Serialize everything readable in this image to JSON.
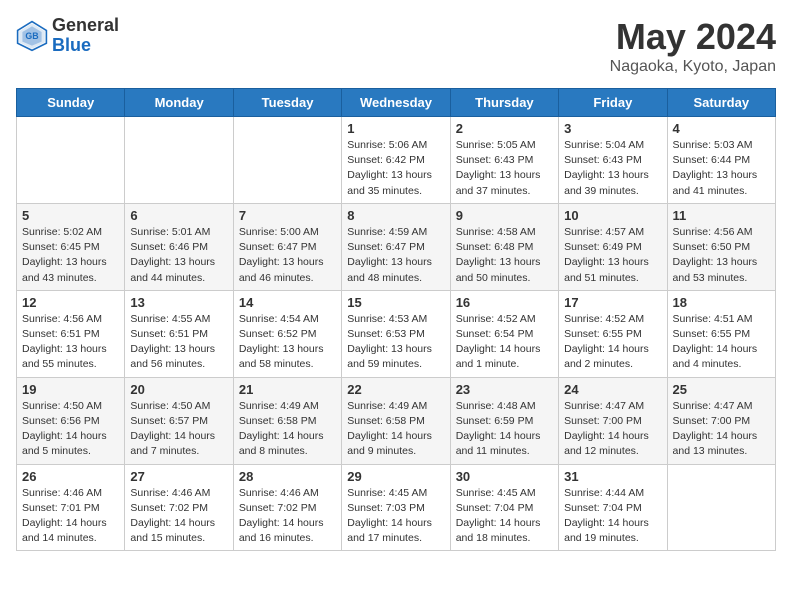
{
  "header": {
    "logo_general": "General",
    "logo_blue": "Blue",
    "month_title": "May 2024",
    "location": "Nagaoka, Kyoto, Japan"
  },
  "weekdays": [
    "Sunday",
    "Monday",
    "Tuesday",
    "Wednesday",
    "Thursday",
    "Friday",
    "Saturday"
  ],
  "weeks": [
    [
      {
        "day": "",
        "info": ""
      },
      {
        "day": "",
        "info": ""
      },
      {
        "day": "",
        "info": ""
      },
      {
        "day": "1",
        "info": "Sunrise: 5:06 AM\nSunset: 6:42 PM\nDaylight: 13 hours\nand 35 minutes."
      },
      {
        "day": "2",
        "info": "Sunrise: 5:05 AM\nSunset: 6:43 PM\nDaylight: 13 hours\nand 37 minutes."
      },
      {
        "day": "3",
        "info": "Sunrise: 5:04 AM\nSunset: 6:43 PM\nDaylight: 13 hours\nand 39 minutes."
      },
      {
        "day": "4",
        "info": "Sunrise: 5:03 AM\nSunset: 6:44 PM\nDaylight: 13 hours\nand 41 minutes."
      }
    ],
    [
      {
        "day": "5",
        "info": "Sunrise: 5:02 AM\nSunset: 6:45 PM\nDaylight: 13 hours\nand 43 minutes."
      },
      {
        "day": "6",
        "info": "Sunrise: 5:01 AM\nSunset: 6:46 PM\nDaylight: 13 hours\nand 44 minutes."
      },
      {
        "day": "7",
        "info": "Sunrise: 5:00 AM\nSunset: 6:47 PM\nDaylight: 13 hours\nand 46 minutes."
      },
      {
        "day": "8",
        "info": "Sunrise: 4:59 AM\nSunset: 6:47 PM\nDaylight: 13 hours\nand 48 minutes."
      },
      {
        "day": "9",
        "info": "Sunrise: 4:58 AM\nSunset: 6:48 PM\nDaylight: 13 hours\nand 50 minutes."
      },
      {
        "day": "10",
        "info": "Sunrise: 4:57 AM\nSunset: 6:49 PM\nDaylight: 13 hours\nand 51 minutes."
      },
      {
        "day": "11",
        "info": "Sunrise: 4:56 AM\nSunset: 6:50 PM\nDaylight: 13 hours\nand 53 minutes."
      }
    ],
    [
      {
        "day": "12",
        "info": "Sunrise: 4:56 AM\nSunset: 6:51 PM\nDaylight: 13 hours\nand 55 minutes."
      },
      {
        "day": "13",
        "info": "Sunrise: 4:55 AM\nSunset: 6:51 PM\nDaylight: 13 hours\nand 56 minutes."
      },
      {
        "day": "14",
        "info": "Sunrise: 4:54 AM\nSunset: 6:52 PM\nDaylight: 13 hours\nand 58 minutes."
      },
      {
        "day": "15",
        "info": "Sunrise: 4:53 AM\nSunset: 6:53 PM\nDaylight: 13 hours\nand 59 minutes."
      },
      {
        "day": "16",
        "info": "Sunrise: 4:52 AM\nSunset: 6:54 PM\nDaylight: 14 hours\nand 1 minute."
      },
      {
        "day": "17",
        "info": "Sunrise: 4:52 AM\nSunset: 6:55 PM\nDaylight: 14 hours\nand 2 minutes."
      },
      {
        "day": "18",
        "info": "Sunrise: 4:51 AM\nSunset: 6:55 PM\nDaylight: 14 hours\nand 4 minutes."
      }
    ],
    [
      {
        "day": "19",
        "info": "Sunrise: 4:50 AM\nSunset: 6:56 PM\nDaylight: 14 hours\nand 5 minutes."
      },
      {
        "day": "20",
        "info": "Sunrise: 4:50 AM\nSunset: 6:57 PM\nDaylight: 14 hours\nand 7 minutes."
      },
      {
        "day": "21",
        "info": "Sunrise: 4:49 AM\nSunset: 6:58 PM\nDaylight: 14 hours\nand 8 minutes."
      },
      {
        "day": "22",
        "info": "Sunrise: 4:49 AM\nSunset: 6:58 PM\nDaylight: 14 hours\nand 9 minutes."
      },
      {
        "day": "23",
        "info": "Sunrise: 4:48 AM\nSunset: 6:59 PM\nDaylight: 14 hours\nand 11 minutes."
      },
      {
        "day": "24",
        "info": "Sunrise: 4:47 AM\nSunset: 7:00 PM\nDaylight: 14 hours\nand 12 minutes."
      },
      {
        "day": "25",
        "info": "Sunrise: 4:47 AM\nSunset: 7:00 PM\nDaylight: 14 hours\nand 13 minutes."
      }
    ],
    [
      {
        "day": "26",
        "info": "Sunrise: 4:46 AM\nSunset: 7:01 PM\nDaylight: 14 hours\nand 14 minutes."
      },
      {
        "day": "27",
        "info": "Sunrise: 4:46 AM\nSunset: 7:02 PM\nDaylight: 14 hours\nand 15 minutes."
      },
      {
        "day": "28",
        "info": "Sunrise: 4:46 AM\nSunset: 7:02 PM\nDaylight: 14 hours\nand 16 minutes."
      },
      {
        "day": "29",
        "info": "Sunrise: 4:45 AM\nSunset: 7:03 PM\nDaylight: 14 hours\nand 17 minutes."
      },
      {
        "day": "30",
        "info": "Sunrise: 4:45 AM\nSunset: 7:04 PM\nDaylight: 14 hours\nand 18 minutes."
      },
      {
        "day": "31",
        "info": "Sunrise: 4:44 AM\nSunset: 7:04 PM\nDaylight: 14 hours\nand 19 minutes."
      },
      {
        "day": "",
        "info": ""
      }
    ]
  ]
}
